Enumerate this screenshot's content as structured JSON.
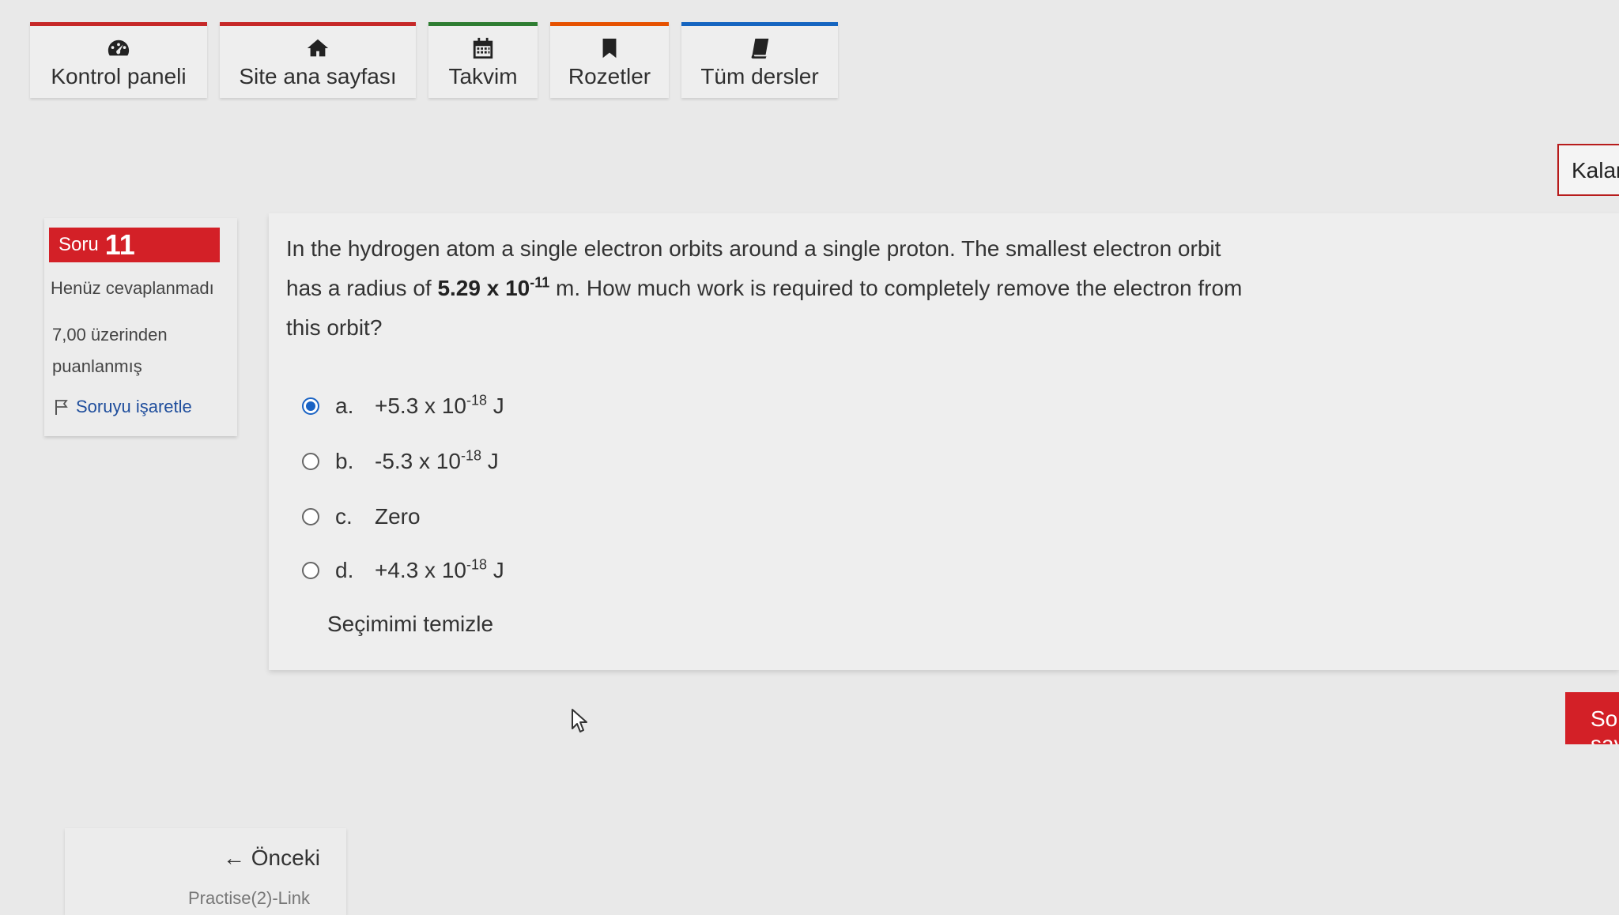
{
  "nav": {
    "tabs": [
      {
        "label": "Kontrol paneli",
        "icon": "dashboard-icon",
        "accent": "#c62828"
      },
      {
        "label": "Site ana sayfası",
        "icon": "home-icon",
        "accent": "#c62828"
      },
      {
        "label": "Takvim",
        "icon": "calendar-icon",
        "accent": "#2e7d32"
      },
      {
        "label": "Rozetler",
        "icon": "bookmark-icon",
        "accent": "#e65100"
      },
      {
        "label": "Tüm dersler",
        "icon": "book-icon",
        "accent": "#1565c0"
      }
    ]
  },
  "timer": {
    "label": "Kalan"
  },
  "question_info": {
    "word": "Soru",
    "number": "11",
    "state": "Henüz cevaplanmadı",
    "grade_line1": "7,00 üzerinden",
    "grade_line2": "puanlanmış",
    "flag_label": "Soruyu işaretle"
  },
  "question": {
    "text_part1": "In the hydrogen atom a single electron orbits around a single proton. The smallest electron orbit has a radius of ",
    "radius_mantissa": "5.29 x 10",
    "radius_exp": "-11",
    "text_part2": " m. How much work is required to completely remove the electron from this orbit?",
    "options": [
      {
        "letter": "a.",
        "base": "+5.3 x 10",
        "exp": "-18",
        "unit": " J",
        "selected": true
      },
      {
        "letter": "b.",
        "base": "-5.3 x 10",
        "exp": "-18",
        "unit": " J",
        "selected": false
      },
      {
        "letter": "c.",
        "base": "Zero",
        "exp": "",
        "unit": "",
        "selected": false
      },
      {
        "letter": "d.",
        "base": "+4.3 x 10",
        "exp": "-18",
        "unit": " J",
        "selected": false
      }
    ],
    "clear_label": "Seçimimi temizle"
  },
  "navigation": {
    "next_label": "Sonraki sayfa",
    "prev_label": "← Önceki",
    "prev_activity": "Practise(2)-Link"
  },
  "colors": {
    "accent_red": "#d32027",
    "link_blue": "#1e4d9c",
    "radio_blue": "#1a63c4"
  }
}
